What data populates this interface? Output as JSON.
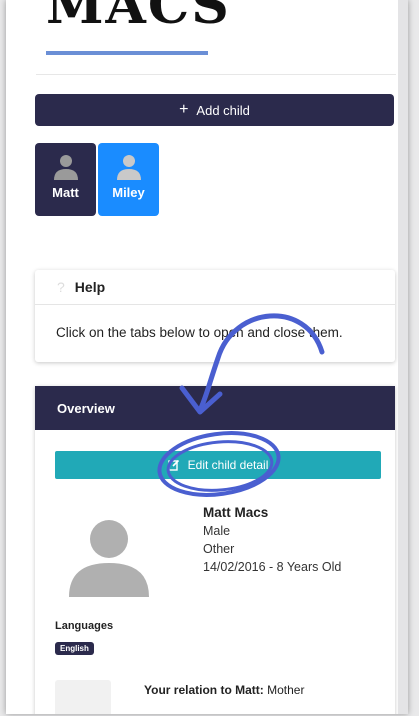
{
  "header": {
    "brand": "MACS"
  },
  "actions": {
    "add_child": "Add child",
    "plus_glyph": "+"
  },
  "children_tabs": [
    {
      "name": "Matt"
    },
    {
      "name": "Miley"
    }
  ],
  "help": {
    "icon_glyph": "?",
    "title": "Help",
    "text": "Click on the tabs below to open and close them."
  },
  "overview": {
    "title": "Overview",
    "edit_label": "Edit child detail",
    "child": {
      "name": "Matt Macs",
      "gender": "Male",
      "other": "Other",
      "dob": "14/02/2016 - 8 Years Old"
    },
    "languages_label": "Languages",
    "languages": [
      "English"
    ],
    "relation_label": "Your relation to Matt:",
    "relation_value": "Mother"
  },
  "colors": {
    "navy": "#2b2a4c",
    "blue": "#1a8cff",
    "teal": "#21a9b7",
    "annotation": "#4a5fd0"
  },
  "icons": {
    "add": "plus-icon",
    "child_avatar": "user-avatar-icon",
    "help": "question-icon",
    "edit": "edit-icon"
  }
}
